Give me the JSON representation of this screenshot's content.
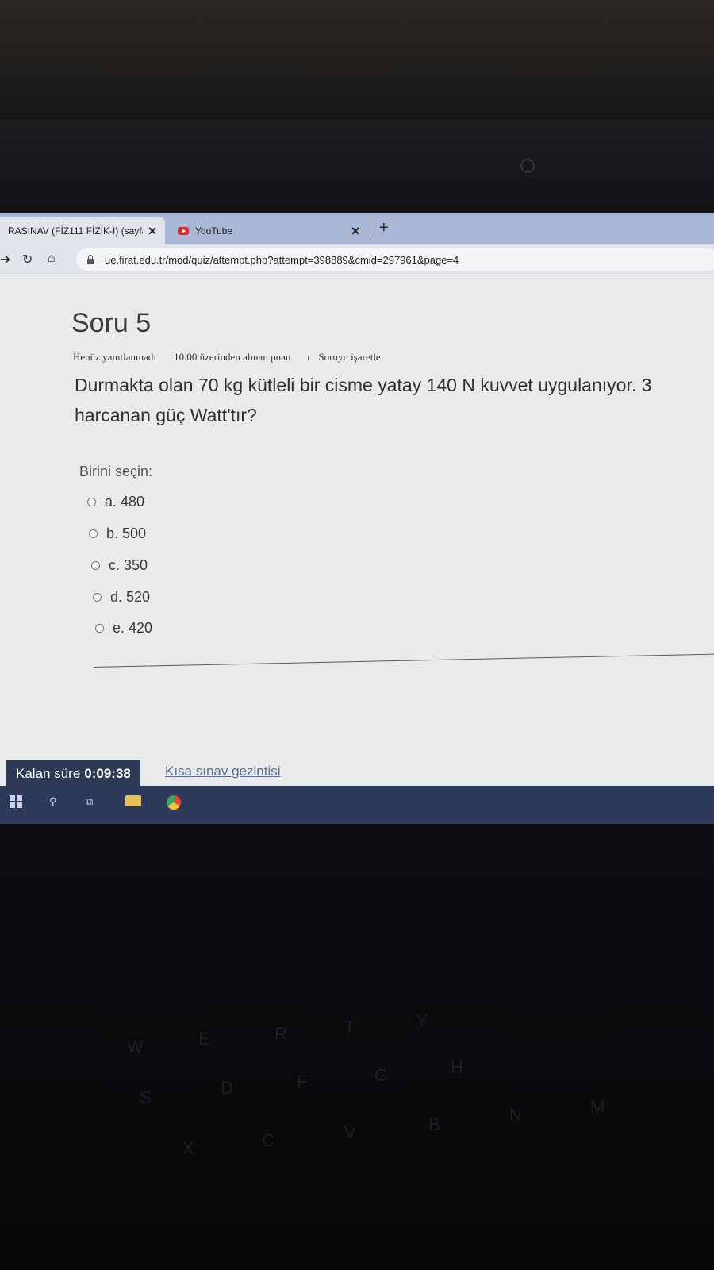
{
  "browser": {
    "tabs": [
      {
        "title": "RASINAV (FİZ111 FİZİK-I) (sayfa",
        "close": "✕"
      },
      {
        "title": "YouTube",
        "close": "✕"
      }
    ],
    "new_tab": "+",
    "url": "ue.firat.edu.tr/mod/quiz/attempt.php?attempt=398889&cmid=297961&page=4"
  },
  "question": {
    "title": "Soru 5",
    "status": "Henüz yanıtlanmadı",
    "points": "10.00 üzerinden alınan puan",
    "flag_label": "Soruyu işaretle",
    "text_line1": "Durmakta olan 70 kg kütleli bir cisme yatay 140 N kuvvet uygulanıyor. 3",
    "text_line2": "harcanan güç Watt'tır?",
    "prompt": "Birini seçin:",
    "options": [
      {
        "label": "a. 480"
      },
      {
        "label": "b. 500"
      },
      {
        "label": "c. 350"
      },
      {
        "label": "d. 520"
      },
      {
        "label": "e. 420"
      }
    ]
  },
  "footer": {
    "timer_label": "Kalan süre",
    "timer_value": "0:09:38",
    "nav_link": "Kısa sınav gezintisi"
  }
}
